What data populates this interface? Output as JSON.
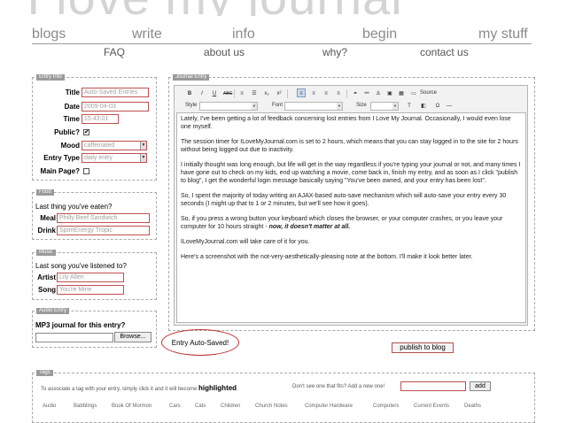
{
  "brand": {
    "title": "I love my journal"
  },
  "nav_primary": [
    "blogs",
    "write",
    "info",
    "begin",
    "my stuff"
  ],
  "nav_secondary": [
    "FAQ",
    "about us",
    "why?",
    "contact us"
  ],
  "entry_info": {
    "legend": "Entry Info",
    "title_label": "Title",
    "title_value": "Auto-Saved Entries",
    "date_label": "Date",
    "date_value": "2009-04-03",
    "time_label": "Time",
    "time_value": "15:43:01",
    "public_label": "Public?",
    "mood_label": "Mood",
    "mood_value": "caffeinated",
    "entry_type_label": "Entry Type",
    "entry_type_value": "daily entry",
    "main_page_label": "Main Page?"
  },
  "food": {
    "legend": "Food",
    "question": "Last thing you've eaten?",
    "meal_label": "Meal",
    "meal_value": "Philly Beef Sandwich",
    "drink_label": "Drink",
    "drink_value": "SportEnergy Tropic"
  },
  "music": {
    "legend": "Music",
    "question": "Last song you've listened to?",
    "artist_label": "Artist",
    "artist_value": "Lily Allen",
    "song_label": "Song",
    "song_value": "You're Mine"
  },
  "audio": {
    "legend": "Audio Entry",
    "question": "MP3 journal for this entry?",
    "browse_label": "Browse..."
  },
  "journal": {
    "legend": "Journal Entry",
    "toolbar": {
      "bold": "B",
      "italic": "I",
      "underline": "U",
      "strike": "ABC",
      "source_label": "Source",
      "style_label": "Style",
      "font_label": "Font",
      "size_label": "Size"
    },
    "paragraphs": [
      "Lately, I've been getting a lot of feedback concerning lost entries from I Love My Journal. Occasionally, I would even lose one myself.",
      "The session timer for ILoveMyJournal.com is set to 2 hours, which means that you can stay logged in to the site for 2 hours without being logged out due to inactivity.",
      "I initially thought was long enough, but life will get in the way regardless if you're typing your journal or not, and many times I have gone out to check on my kids, end up watching a movie, come back in, finish my entry, and as soon as I click \"publish to blog\", I get the wonderful login message basically saying \"You've been owned, and your entry has been lost\".",
      "So, I spent the majority of today writing an AJAX-based auto-save mechanism which will auto-save your entry every 30 seconds (I might up that to 1 or 2 minutes, but we'll see how it goes).",
      "So, if you press a wrong button your keyboard which closes the browser, or your computer crashes, or you leave your computer for 10 hours straight - ",
      "now, it doesn't matter at all.",
      "ILoveMyJournal.com will take care of it for you.",
      "Here's a screenshot with the not-very-aesthetically-pleasing note at the bottom. I'll make it look better later."
    ]
  },
  "status": {
    "saved": "Entry Auto-Saved!"
  },
  "publish_label": "publish to blog",
  "tags": {
    "legend": "Tags",
    "hint_prefix": "To associate a tag with your entry, simply click it and it will become",
    "hint_highlight": "highlighted",
    "hint_suffix": "Don't see one that fits? Add a new one!",
    "add_label": "add",
    "items": [
      "Audio",
      "Babblings",
      "Book Of Mormon",
      "Cars",
      "Cats",
      "Children",
      "Church Notes",
      "Computer Hardware",
      "Computers",
      "Current Events",
      "Deaths"
    ]
  }
}
